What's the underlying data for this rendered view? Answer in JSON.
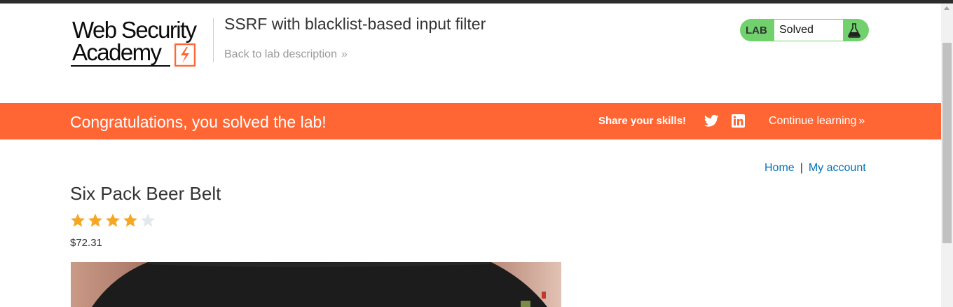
{
  "header": {
    "logo": {
      "line1": "Web Security",
      "line2": "Academy"
    },
    "lab_title": "SSRF with blacklist-based input filter",
    "back_link": "Back to lab description",
    "lab_status": {
      "tag": "LAB",
      "value": "Solved"
    }
  },
  "banner": {
    "message": "Congratulations, you solved the lab!",
    "share_label": "Share your skills!",
    "continue_label": "Continue learning"
  },
  "nav": {
    "home": "Home",
    "separator": "|",
    "account": "My account"
  },
  "product": {
    "title": "Six Pack Beer Belt",
    "rating": 4,
    "rating_max": 5,
    "price": "$72.31"
  },
  "colors": {
    "accent": "#ff6633",
    "lab_status_green": "#70d16d",
    "link": "#0071bc",
    "star_filled": "#f5a623",
    "star_empty": "#e3e8ec"
  },
  "icons": {
    "chevron": "double-chevron-right-icon",
    "twitter": "twitter-icon",
    "linkedin": "linkedin-icon",
    "flask": "flask-icon"
  }
}
